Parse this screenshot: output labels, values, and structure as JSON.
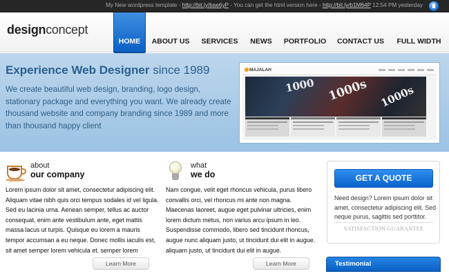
{
  "topbar": {
    "prefix": "My New wordpress template - ",
    "link1": "http://bit.ly/bae6yP",
    "middle": " - You can get the html version here - ",
    "link2": "http://bit.ly/b1M64P",
    "time": " 12:54 PM yesterday"
  },
  "logo": {
    "bold": "design",
    "light": "concept"
  },
  "nav": [
    {
      "label": "HOME",
      "active": true
    },
    {
      "label": "ABOUT US"
    },
    {
      "label": "SERVICES"
    },
    {
      "label": "NEWS"
    },
    {
      "label": "PORTFOLIO"
    },
    {
      "label": "CONTACT US"
    },
    {
      "label": "FULL WIDTH"
    }
  ],
  "hero": {
    "title_bold": "Experience Web Designer",
    "title_rest": " since 1989",
    "text": "We create beautiful web design, branding, logo design, stationary package and everything you want. We already create thousand website and company branding since 1989 and more than thousand happy client"
  },
  "screenshot": {
    "logo": "MAJALAH",
    "photo_text_1": "1000",
    "photo_text_2": "1000s",
    "photo_text_3": "1000s"
  },
  "about": {
    "small": "about",
    "big": "our company",
    "text": "Lorem ipsum dolor sit amet, consectetur adipiscing elit. Aliquam vitae nibh quis orci tempus sodales id vel ligula. Sed eu lacinia urna. Aenean semper, tellus ac auctor consequat, enim ante vestibulum ante, eget mattis massa lacus ut turpis. Quisque eu lorem a mauris tempor accumsan a eu neque. Donec mollis iaculis est, sit amet semper lorem vehicula et. semper lorem",
    "button": "Learn More"
  },
  "whatwedo": {
    "small": "what",
    "big": "we do",
    "text": "Nam congue, velit eget rhoncus vehicula, purus libero convallis orci, vel rhoncus mi ante non magna. Maecenas laoreet, augue eget pulvinar ultricies, enim lorem dictum metus, non varius arcu ipsum in leo. Suspendisse commodo, libero sed tincidunt rhoncus, augue nunc aliquam justo, ut tincidunt dui elit in augue. aliquam justo, ut tincidunt dui elit in augue.",
    "button": "Learn More"
  },
  "sidebar": {
    "quote_button": "GET A QUOTE",
    "quote_text": "Need design? Lorem ipsum dolor sit amet, consectetur adipiscing elit. Sed neque purus, sagittis sed porttitor.",
    "guarantee": "SATISFACTION GUARANTEE",
    "testimonial": "Testimonial"
  },
  "colors": {
    "accent": "#0a62cc",
    "hero_bg": "#a9cbe8",
    "hero_text": "#2a5f8f",
    "topbar_bg": "#262626"
  }
}
